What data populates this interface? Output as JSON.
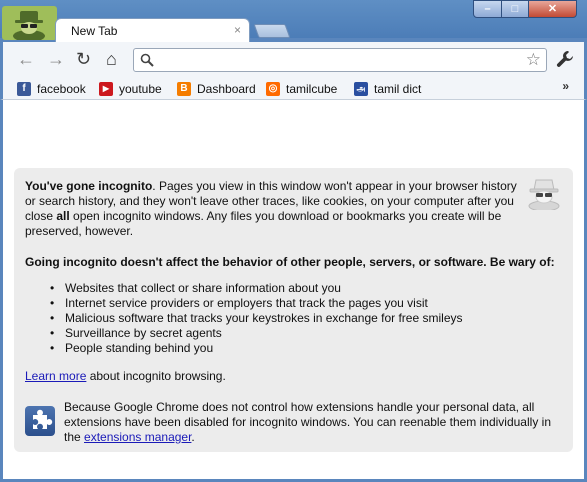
{
  "tab": {
    "title": "New Tab",
    "close": "×"
  },
  "window": {
    "min": "–",
    "max": "□",
    "close": "✕"
  },
  "toolbar": {
    "back": "←",
    "forward": "→",
    "reload": "↻",
    "home": "⌂",
    "search_glyph": "🔍",
    "star": "☆",
    "wrench": "🔧",
    "omnibox_value": ""
  },
  "bookmarks": {
    "items": [
      {
        "label": "facebook",
        "icon": "facebook-icon",
        "color": "#3b5998",
        "glyph": "f"
      },
      {
        "label": "youtube",
        "icon": "youtube-icon",
        "color": "#cc181e",
        "glyph": "▶"
      },
      {
        "label": "Dashboard",
        "icon": "blogger-icon",
        "color": "#f57d00",
        "glyph": "B"
      },
      {
        "label": "tamilcube",
        "icon": "tamilcube-icon",
        "color": "#ff6a00",
        "glyph": "◎"
      },
      {
        "label": "tamil dict",
        "icon": "tamildict-icon",
        "color": "#2a4fa0",
        "glyph": "அ"
      }
    ],
    "overflow": "»"
  },
  "incognito": {
    "intro_bold": "You've gone incognito",
    "intro_1": ". Pages you view in this window won't appear in your browser history or search history, and they won't leave other traces, like cookies, on your computer after you close ",
    "intro_all": "all",
    "intro_2": " open incognito windows. Any files you download or bookmarks you create will be preserved, however.",
    "warning": "Going incognito doesn't affect the behavior of other people, servers, or software. Be wary of:",
    "list": [
      "Websites that collect or share information about you",
      "Internet service providers or employers that track the pages you visit",
      "Malicious software that tracks your keystrokes in exchange for free smileys",
      "Surveillance by secret agents",
      "People standing behind you"
    ],
    "learn_link": "Learn more",
    "learn_rest": " about incognito browsing.",
    "ext_text": "Because Google Chrome does not control how extensions handle your personal data, all extensions have been disabled for incognito windows. You can reenable them individually in the ",
    "ext_link": "extensions manager",
    "ext_end": "."
  },
  "colors": {
    "frame": "#5a86bd",
    "link": "#1a1ab8",
    "panel": "#ececec"
  }
}
